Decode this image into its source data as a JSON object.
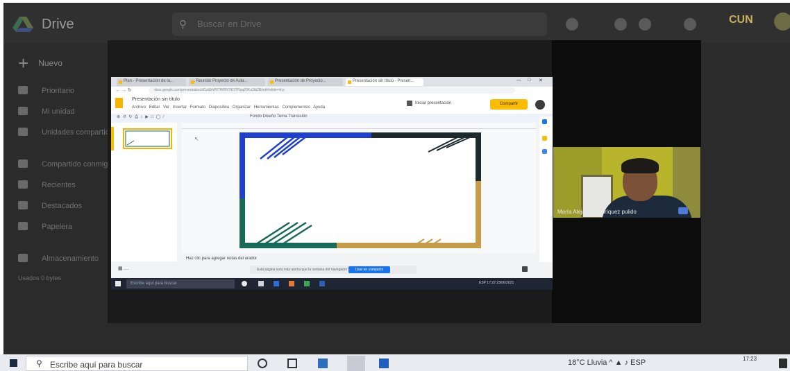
{
  "drive": {
    "title": "Drive",
    "search_placeholder": "Buscar en Drive",
    "new_label": "Nuevo",
    "brand": "CUN",
    "sidebar": [
      {
        "label": "Prioritario",
        "icon": "priority-icon"
      },
      {
        "label": "Mi unidad",
        "icon": "my-drive-icon"
      },
      {
        "label": "Unidades compartidas",
        "icon": "shared-drives-icon"
      },
      {
        "label": "Compartido conmigo",
        "icon": "shared-icon"
      },
      {
        "label": "Recientes",
        "icon": "clock-icon"
      },
      {
        "label": "Destacados",
        "icon": "star-icon"
      },
      {
        "label": "Papelera",
        "icon": "trash-icon"
      },
      {
        "label": "Almacenamiento",
        "icon": "cloud-icon"
      },
      {
        "label": "Usados 0 bytes",
        "icon": ""
      }
    ]
  },
  "meeting": {
    "participant_name": "María Alejandra Enríquez pulido"
  },
  "browser": {
    "tabs": [
      {
        "label": "Plan - Presentación de la..."
      },
      {
        "label": "Reunión Proyecto de Aula..."
      },
      {
        "label": "Presentación de Proyecto..."
      },
      {
        "label": "Presentación sin título - Presen..."
      }
    ],
    "url": "docs.google.com/presentation/d/1zt8xW0TWRN7IE3TRpqZ0Ko2tb2B/edit#slide=id.p",
    "doc_title": "Presentación sin título",
    "menu": [
      "Archivo",
      "Editar",
      "Ver",
      "Insertar",
      "Formato",
      "Diapositiva",
      "Organizar",
      "Herramientas",
      "Complementos",
      "Ayuda"
    ],
    "present_label": "Iniciar presentación",
    "share_label": "Compartir",
    "toolbar_text": "Fondo   Diseño   Tema   Transición",
    "speaker_notes": "Haz clic para agregar notas del orador",
    "notice_text": "Esta página está más ancha que la ventana del navegador",
    "notice_button": "Usar en compacto",
    "win_search": "Escribe aquí para buscar",
    "win_tray": "ESP   17:22   23/06/2021"
  },
  "taskbar": {
    "search_placeholder": "Escribe aquí para buscar",
    "tray": "18°C Lluvia  ^  ▲  ♪  ESP",
    "time": "17:23"
  },
  "colors": {
    "slide_blue": "#1f3fcf",
    "slide_dark": "#1c2a2e",
    "slide_green": "#176a57",
    "slide_gold": "#c59d4a",
    "share_yellow": "#fbbc04"
  }
}
